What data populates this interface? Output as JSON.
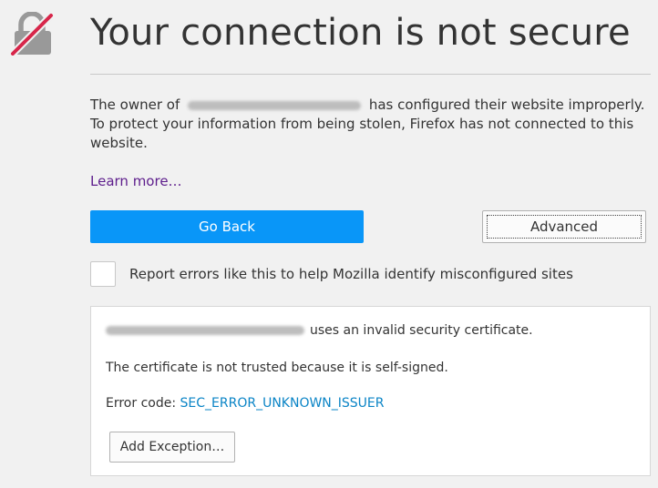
{
  "page": {
    "title": "Your connection is not secure",
    "description": {
      "prefix": "The owner of",
      "suffix": "has configured their website improperly. To protect your information from being stolen, Firefox has not connected to this website."
    },
    "learn_more": "Learn more…",
    "go_back_label": "Go Back",
    "advanced_label": "Advanced",
    "report_checkbox": {
      "label": "Report errors like this to help Mozilla identify misconfigured sites",
      "checked": false
    }
  },
  "details": {
    "invalid_cert_suffix": "uses an invalid security certificate.",
    "trust_reason": "The certificate is not trusted because it is self-signed.",
    "error_code_label": "Error code:",
    "error_code": "SEC_ERROR_UNKNOWN_ISSUER",
    "add_exception_label": "Add Exception…"
  },
  "colors": {
    "primary_button": "#0996f8",
    "learn_more_link": "#5d1d8c",
    "error_code_link": "#0a84c6",
    "lock_strike": "#d7264a",
    "lock_body": "#999999"
  },
  "icons": {
    "lock": "broken-lock-icon"
  }
}
